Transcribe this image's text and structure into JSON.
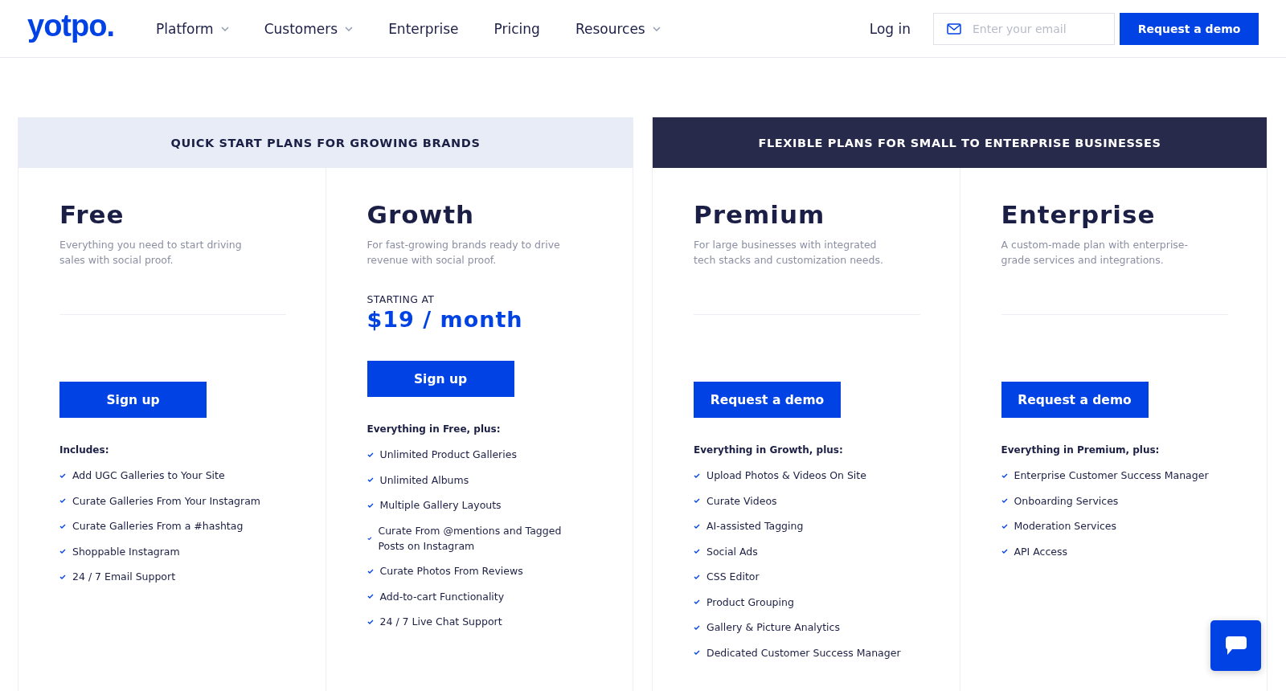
{
  "header": {
    "logo": "yotpo.",
    "nav": [
      {
        "label": "Platform",
        "dropdown": true
      },
      {
        "label": "Customers",
        "dropdown": true
      },
      {
        "label": "Enterprise",
        "dropdown": false
      },
      {
        "label": "Pricing",
        "dropdown": false
      },
      {
        "label": "Resources",
        "dropdown": true
      }
    ],
    "login": "Log in",
    "email": {
      "placeholder": "Enter your email"
    },
    "cta": "Request a demo"
  },
  "groups": [
    {
      "title": "QUICK START PLANS FOR GROWING BRANDS",
      "kind": "light",
      "plans": [
        {
          "name": "Free",
          "description": "Everything you need to start driving sales with social proof.",
          "button": "Sign up",
          "includes_title": "Includes:",
          "features": [
            "Add UGC Galleries to Your Site",
            "Curate Galleries From Your Instagram",
            "Curate Galleries From a #hashtag",
            "Shoppable Instagram",
            "24 / 7 Email Support"
          ]
        },
        {
          "name": "Growth",
          "description": "For fast-growing brands ready to drive revenue with social proof.",
          "price_label": "STARTING AT",
          "price": "$19 / month",
          "button": "Sign up",
          "includes_title": "Everything in Free, plus:",
          "features": [
            "Unlimited Product Galleries",
            "Unlimited Albums",
            "Multiple Gallery Layouts",
            "Curate From @mentions and Tagged Posts on Instagram",
            "Curate Photos From Reviews",
            "Add-to-cart Functionality",
            "24 / 7 Live Chat Support"
          ]
        }
      ]
    },
    {
      "title": "FLEXIBLE PLANS FOR SMALL TO ENTERPRISE BUSINESSES",
      "kind": "dark",
      "plans": [
        {
          "name": "Premium",
          "description": "For large businesses with integrated tech stacks and customization needs.",
          "button": "Request a demo",
          "includes_title": "Everything in Growth, plus:",
          "features": [
            "Upload Photos & Videos On Site",
            "Curate Videos",
            "AI-assisted Tagging",
            "Social Ads",
            "CSS Editor",
            "Product Grouping",
            "Gallery & Picture Analytics",
            "Dedicated Customer Success Manager"
          ]
        },
        {
          "name": "Enterprise",
          "description": "A custom-made plan with enterprise-grade services and integrations.",
          "button": "Request a demo",
          "includes_title": "Everything in Premium, plus:",
          "features": [
            "Enterprise Customer Success Manager",
            "Onboarding Services",
            "Moderation Services",
            "API Access"
          ]
        }
      ]
    }
  ]
}
